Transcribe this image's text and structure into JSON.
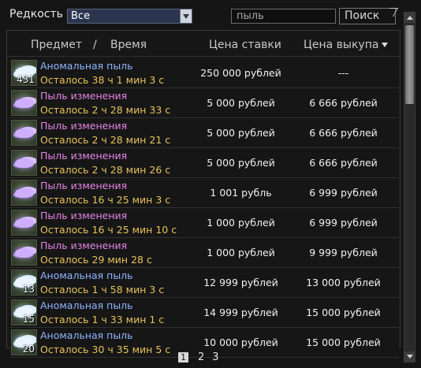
{
  "filter": {
    "rarity_label": "Редкость",
    "rarity_value": "Все",
    "search_value": "пыль",
    "search_button": "Поиск"
  },
  "table": {
    "headers": {
      "item": "Предмет",
      "slash": "/",
      "time": "Время",
      "bid": "Цена ставки",
      "buyout": "Цена выкупа"
    },
    "rows": [
      {
        "name": "Аномальная пыль",
        "type": "anomalous",
        "qty": "431",
        "time_left": "Осталось 38 ч 1 мин 3 с",
        "bid": "250 000 рублей",
        "buyout": "---"
      },
      {
        "name": "Пыль изменения",
        "type": "change",
        "qty": "",
        "time_left": "Осталось 2 ч 28 мин 33 с",
        "bid": "5 000 рублей",
        "buyout": "6 666 рублей"
      },
      {
        "name": "Пыль изменения",
        "type": "change",
        "qty": "",
        "time_left": "Осталось 2 ч 28 мин 21 с",
        "bid": "5 000 рублей",
        "buyout": "6 666 рублей"
      },
      {
        "name": "Пыль изменения",
        "type": "change",
        "qty": "",
        "time_left": "Осталось 2 ч 28 мин 26 с",
        "bid": "5 000 рублей",
        "buyout": "6 666 рублей"
      },
      {
        "name": "Пыль изменения",
        "type": "change",
        "qty": "",
        "time_left": "Осталось 16 ч 25 мин 3 с",
        "bid": "1 001 рубль",
        "buyout": "6 999 рублей"
      },
      {
        "name": "Пыль изменения",
        "type": "change",
        "qty": "",
        "time_left": "Осталось 16 ч 25 мин 10 с",
        "bid": "1 000 рублей",
        "buyout": "6 999 рублей"
      },
      {
        "name": "Пыль изменения",
        "type": "change",
        "qty": "",
        "time_left": "Осталось 29 мин 28 с",
        "bid": "1 000 рублей",
        "buyout": "9 999 рублей"
      },
      {
        "name": "Аномальная пыль",
        "type": "anomalous",
        "qty": "13",
        "time_left": "Осталось 1 ч 58 мин 3 с",
        "bid": "12 999 рублей",
        "buyout": "13 000 рублей"
      },
      {
        "name": "Аномальная пыль",
        "type": "anomalous",
        "qty": "15",
        "time_left": "Осталось 1 ч 33 мин 1 с",
        "bid": "14 999 рублей",
        "buyout": "15 000 рублей"
      },
      {
        "name": "Аномальная пыль",
        "type": "anomalous",
        "qty": "20",
        "time_left": "Осталось 30 ч 35 мин 5 с",
        "bid": "10 000 рублей",
        "buyout": "15 000 рублей"
      }
    ]
  },
  "pagination": {
    "pages": [
      "1",
      "2",
      "3"
    ],
    "current": "1"
  },
  "colors": {
    "background": "#151515",
    "anomalous_name": "#8fb4ff",
    "change_name": "#e484e4",
    "time_left": "#e7c35a"
  },
  "icons": {
    "anomalous": "white-dust-cloud-icon",
    "change": "purple-dust-cloud-icon",
    "sort": "sort-descending-icon"
  }
}
